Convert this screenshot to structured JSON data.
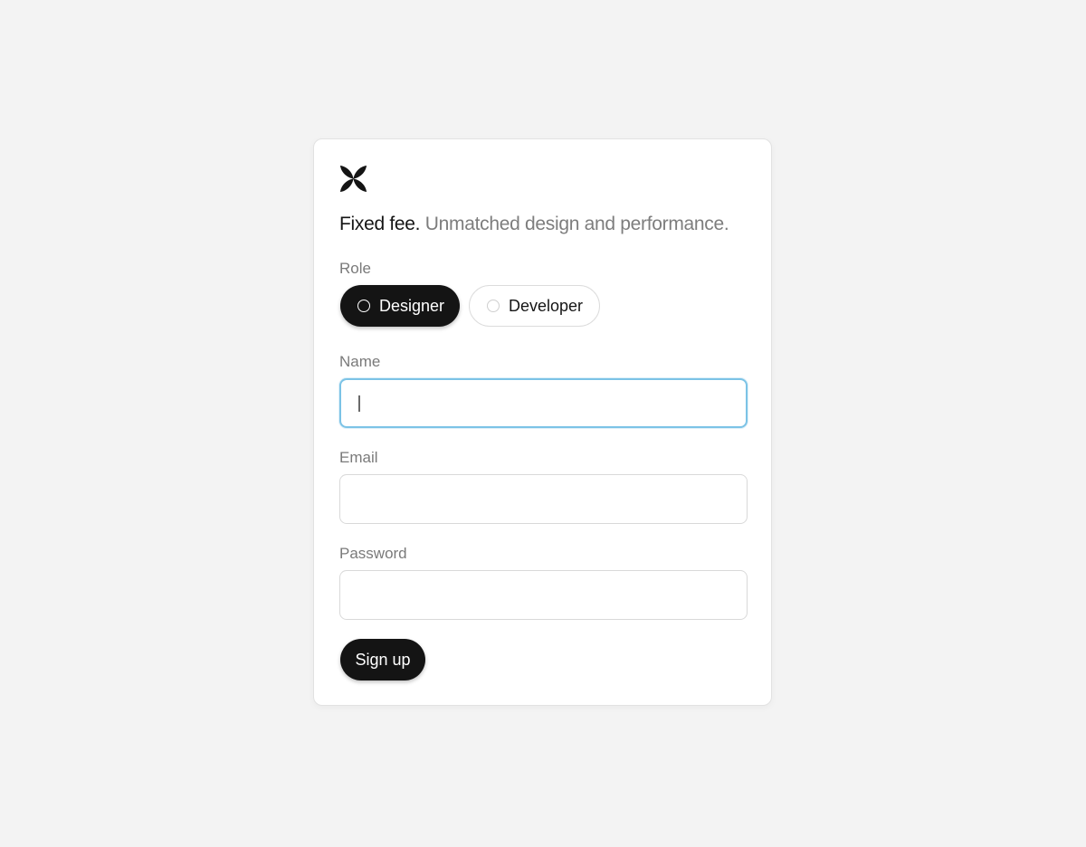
{
  "brand": {
    "logo_icon": "four-petal-flower-icon",
    "color": "#141414"
  },
  "headline": {
    "strong": "Fixed fee.",
    "muted": "Unmatched design and performance."
  },
  "role": {
    "label": "Role",
    "options": [
      {
        "label": "Designer",
        "selected": true
      },
      {
        "label": "Developer",
        "selected": false
      }
    ]
  },
  "fields": {
    "name": {
      "label": "Name",
      "value": "",
      "placeholder": "",
      "focused": true
    },
    "email": {
      "label": "Email",
      "value": "",
      "placeholder": ""
    },
    "password": {
      "label": "Password",
      "value": "",
      "placeholder": ""
    }
  },
  "submit": {
    "label": "Sign up"
  },
  "colors": {
    "background": "#f3f3f3",
    "card": "#ffffff",
    "primary": "#141414",
    "muted_text": "#7d7d7d",
    "focus_ring": "#7cc3e6",
    "border": "#d9d9d9"
  }
}
